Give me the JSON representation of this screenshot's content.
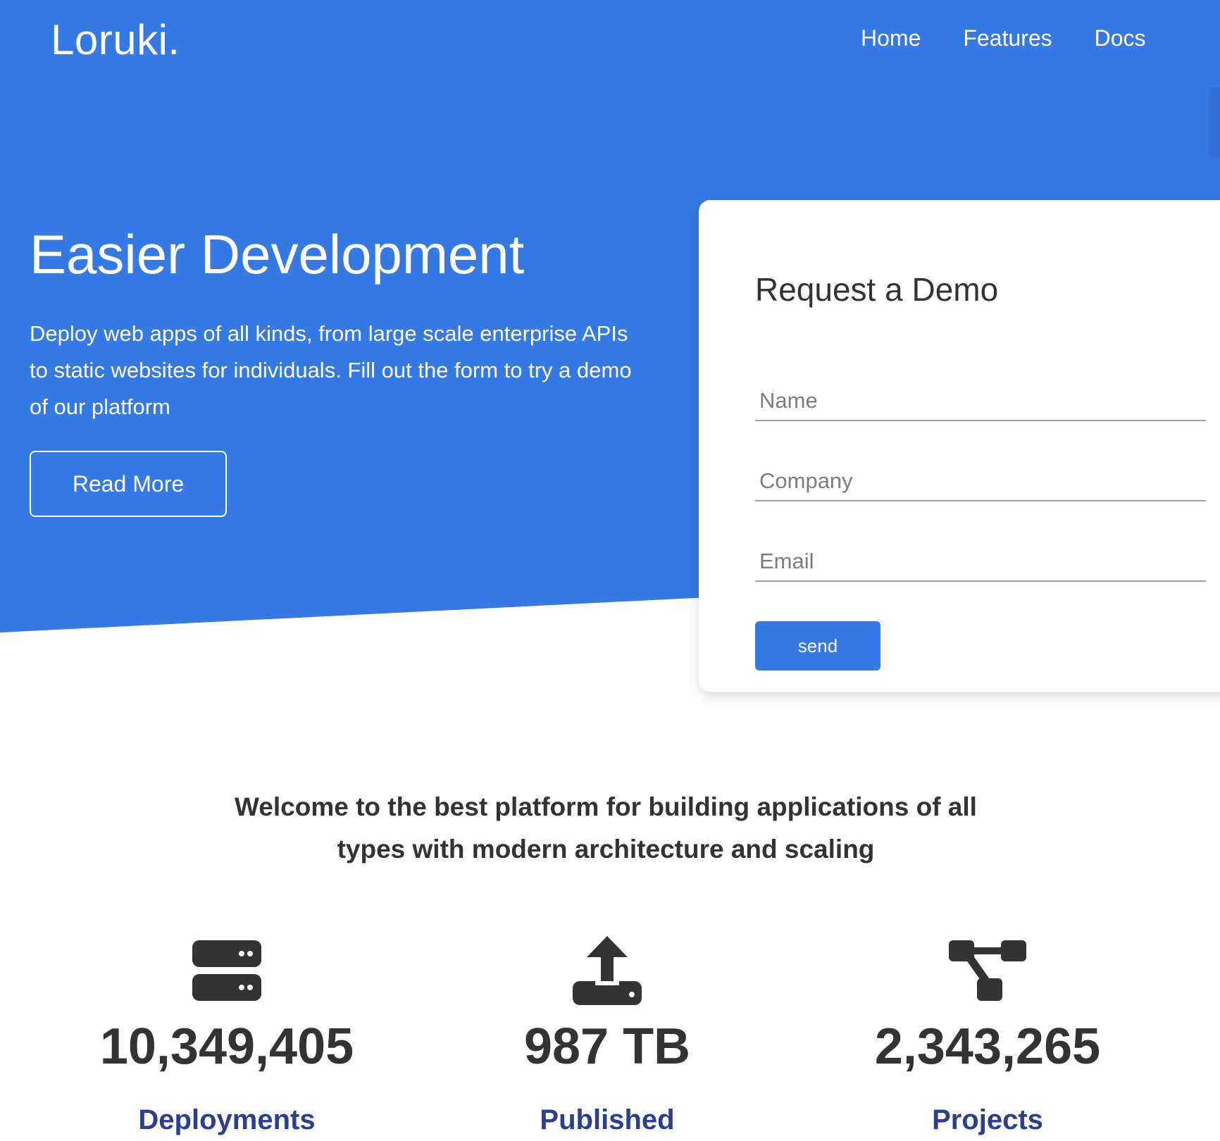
{
  "brand": {
    "logo": "Loruki.",
    "accent_color": "#3579e4"
  },
  "nav": {
    "items": [
      {
        "label": "Home"
      },
      {
        "label": "Features"
      },
      {
        "label": "Docs"
      }
    ]
  },
  "hero": {
    "title": "Easier Development",
    "text": "Deploy web apps of all kinds, from large scale enterprise APIs to static websites for individuals. Fill out the form to try a demo of our platform",
    "button_label": "Read More"
  },
  "form": {
    "title": "Request a Demo",
    "name_placeholder": "Name",
    "company_placeholder": "Company",
    "email_placeholder": "Email",
    "send_label": "send"
  },
  "welcome": {
    "text": "Welcome to the best platform for building applications of all types with modern architecture and scaling"
  },
  "stats": [
    {
      "icon": "server-icon",
      "value": "10,349,405",
      "label": "Deployments"
    },
    {
      "icon": "upload-icon",
      "value": "987 TB",
      "label": "Published"
    },
    {
      "icon": "project-diagram-icon",
      "value": "2,343,265",
      "label": "Projects"
    }
  ]
}
